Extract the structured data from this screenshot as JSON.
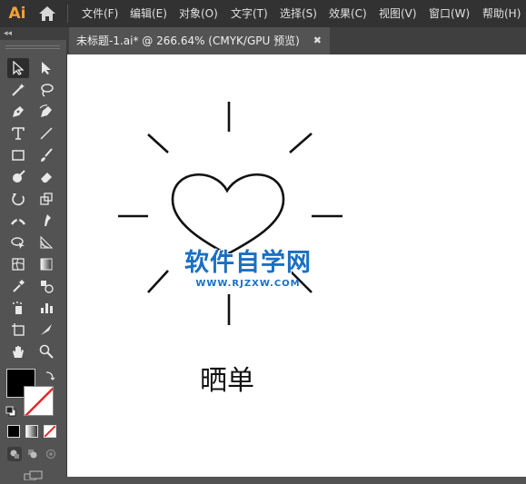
{
  "app": {
    "logo": "Ai"
  },
  "menu": [
    "文件(F)",
    "编辑(E)",
    "对象(O)",
    "文字(T)",
    "选择(S)",
    "效果(C)",
    "视图(V)",
    "窗口(W)",
    "帮助(H)"
  ],
  "tab": {
    "title": "未标题-1.ai* @ 266.64% (CMYK/GPU 预览)",
    "close": "✖"
  },
  "panel": {
    "collapse": "◂◂"
  },
  "canvas": {
    "caption": "晒单"
  },
  "watermark": {
    "title": "软件自学网",
    "url": "WWW.RJZXW.COM"
  },
  "colors": {
    "accent": "#f7a034",
    "stroke": "#111111",
    "watermark": "#1a6fc4"
  },
  "tools": [
    "selection-tool",
    "direct-selection-tool",
    "magic-wand-tool",
    "lasso-tool",
    "pen-tool",
    "curvature-tool",
    "type-tool",
    "line-segment-tool",
    "rectangle-tool",
    "paintbrush-tool",
    "shaper-tool",
    "eraser-tool",
    "rotate-tool",
    "scale-tool",
    "width-tool",
    "puppet-warp-tool",
    "shape-builder-tool",
    "perspective-grid-tool",
    "mesh-tool",
    "gradient-tool",
    "eyedropper-tool",
    "blend-tool",
    "symbol-sprayer-tool",
    "column-graph-tool",
    "artboard-tool",
    "slice-tool",
    "hand-tool",
    "zoom-tool"
  ]
}
